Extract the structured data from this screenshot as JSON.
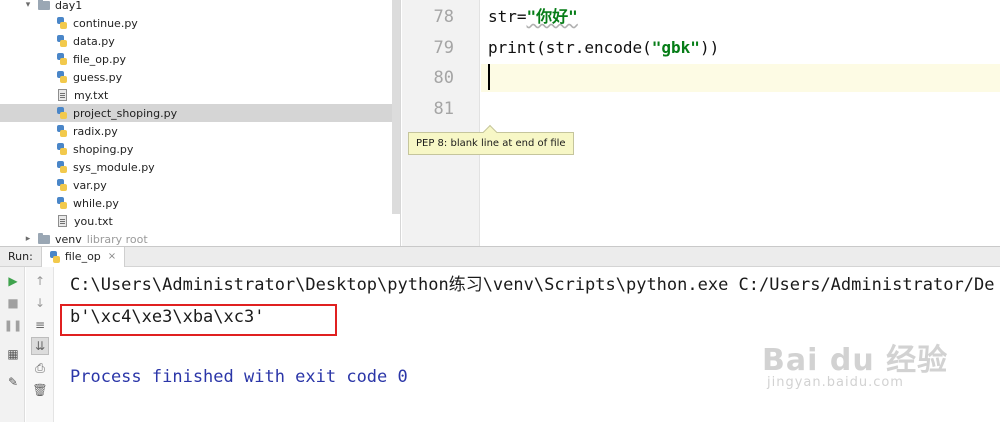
{
  "project_tree": {
    "folder": "day1",
    "files": [
      "continue.py",
      "data.py",
      "file_op.py",
      "guess.py",
      "my.txt",
      "project_shoping.py",
      "radix.py",
      "shoping.py",
      "sys_module.py",
      "var.py",
      "while.py",
      "you.txt"
    ],
    "selected": "project_shoping.py",
    "venv": {
      "name": "venv",
      "hint": "library root"
    }
  },
  "editor": {
    "line_numbers": [
      "78",
      "79",
      "80",
      "81"
    ],
    "line78": {
      "code_prefix": "str=",
      "string_literal": "\"你好\""
    },
    "line79": {
      "code_prefix": "print(str.encode(",
      "string_literal": "\"gbk\"",
      "code_suffix": "))"
    },
    "tooltip": "PEP 8: blank line at end of file"
  },
  "run_panel": {
    "title": "Run:",
    "tab": "file_op",
    "lines": {
      "command": "C:\\Users\\Administrator\\Desktop\\python练习\\venv\\Scripts\\python.exe C:/Users/Administrator/De",
      "output": "b'\\xc4\\xe3\\xba\\xc3'",
      "finished": "Process finished with exit code 0"
    }
  },
  "watermark": {
    "brand": "Bai du 经验",
    "url": "jingyan.baidu.com"
  },
  "colors": {
    "highlight_box": "#e02020",
    "string_literal": "#067d17",
    "console_finish": "#2b36a8",
    "tooltip_bg": "#f7f7c6"
  }
}
